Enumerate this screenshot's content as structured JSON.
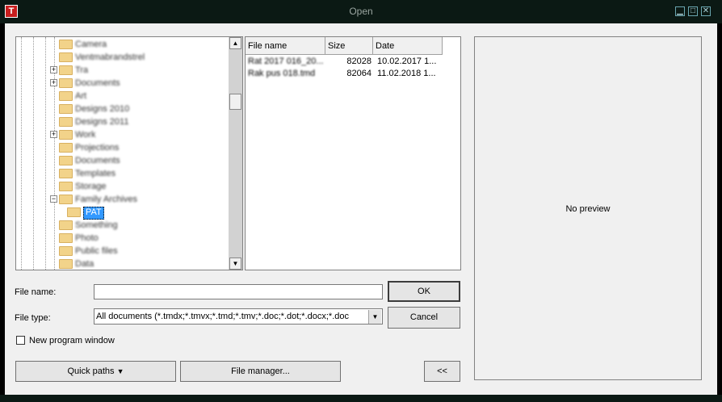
{
  "window": {
    "title": "Open",
    "app_icon": "T",
    "controls": {
      "minimize": "▁",
      "maximize": "□",
      "close": "✕"
    }
  },
  "tree": {
    "items": [
      {
        "label": "Camera",
        "expander": ""
      },
      {
        "label": "Ventmabrandstrel",
        "expander": ""
      },
      {
        "label": "Tra",
        "expander": "+"
      },
      {
        "label": "Documents",
        "expander": "+"
      },
      {
        "label": "Art",
        "expander": ""
      },
      {
        "label": "Designs 2010",
        "expander": ""
      },
      {
        "label": "Designs 2011",
        "expander": ""
      },
      {
        "label": "Work",
        "expander": "+"
      },
      {
        "label": "Projections",
        "expander": ""
      },
      {
        "label": "Documents",
        "expander": ""
      },
      {
        "label": "Templates",
        "expander": ""
      },
      {
        "label": "Storage",
        "expander": ""
      },
      {
        "label": "Family Archives",
        "expander": "−"
      },
      {
        "label": "PAT",
        "expander": "",
        "selected": true
      },
      {
        "label": "Something",
        "expander": ""
      },
      {
        "label": "Photo",
        "expander": ""
      },
      {
        "label": "Public files",
        "expander": ""
      },
      {
        "label": "Data",
        "expander": ""
      }
    ]
  },
  "file_list": {
    "columns": [
      "File name",
      "Size",
      "Date"
    ],
    "rows": [
      {
        "name": "Rat 2017 016_20...",
        "size": "82028",
        "date": "10.02.2017 1..."
      },
      {
        "name": "Rak pus 018.tmd",
        "size": "82064",
        "date": "11.02.2018 1..."
      }
    ]
  },
  "preview": {
    "text": "No preview"
  },
  "form": {
    "file_name_label": "File name:",
    "file_name_value": "",
    "file_type_label": "File type:",
    "file_type_value": "All documents (*.tmdx;*.tmvx;*.tmd;*.tmv;*.doc;*.dot;*.docx;*.doc",
    "new_window_label": "New program window",
    "new_window_checked": false
  },
  "buttons": {
    "ok": "OK",
    "cancel": "Cancel",
    "quick_paths": "Quick paths",
    "file_manager": "File manager...",
    "toggle_preview": "<<"
  }
}
